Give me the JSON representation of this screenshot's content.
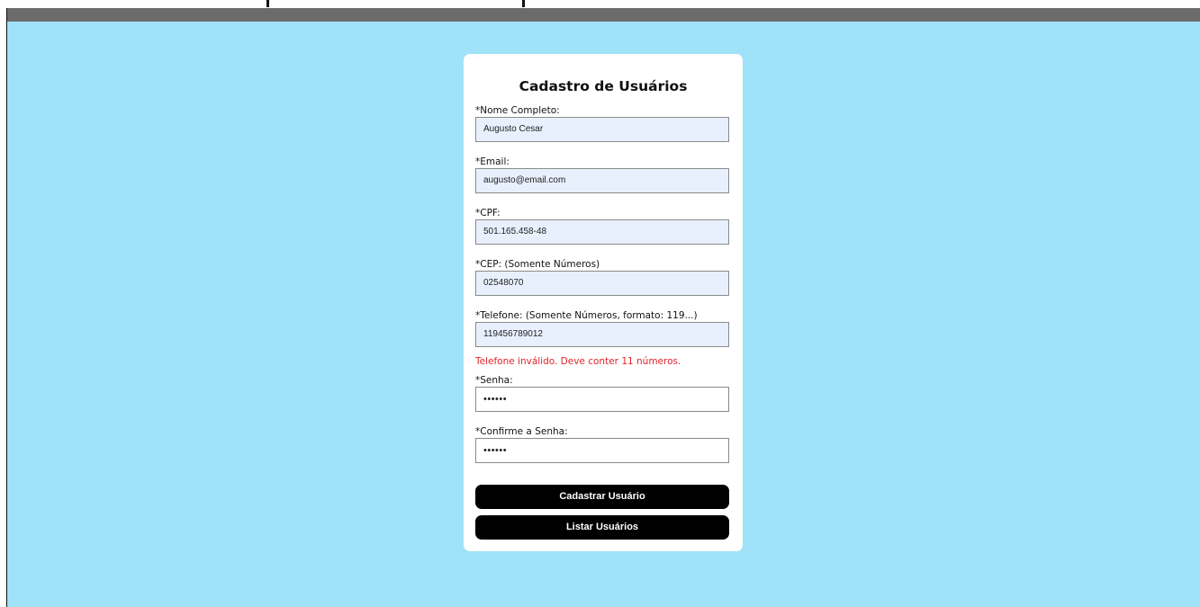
{
  "form": {
    "title": "Cadastro de Usuários",
    "fields": [
      {
        "label": "*Nome Completo:",
        "value": "Augusto Cesar"
      },
      {
        "label": "*Email:",
        "value": "augusto@email.com"
      },
      {
        "label": "*CPF:",
        "value": "501.165.458-48"
      },
      {
        "label": "*CEP: (Somente Números)",
        "value": "02548070"
      },
      {
        "label": "*Telefone: (Somente Números, formato: 119...)",
        "value": "119456789012"
      },
      {
        "label": "*Senha:",
        "value": "••••••"
      },
      {
        "label": "*Confirme a Senha:",
        "value": "••••••"
      }
    ],
    "error": "Telefone inválido. Deve conter 11 números.",
    "register_button": "Cadastrar Usuário",
    "list_button": "Listar Usuários"
  },
  "colors": {
    "background": "#a0e2f7",
    "card": "#ffffff",
    "autofill_input": "#e8f0fe",
    "error_text": "#e0232a",
    "button": "#000000"
  }
}
